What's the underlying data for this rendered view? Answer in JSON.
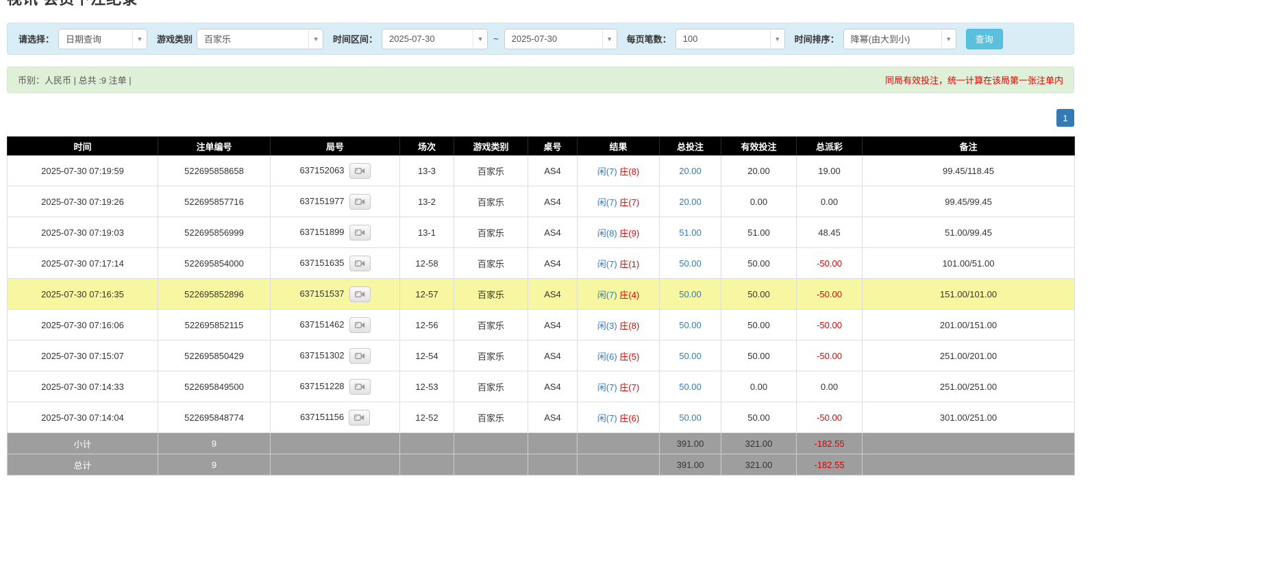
{
  "page": {
    "title": "视讯 会员下注纪录"
  },
  "colors": {
    "header_bg": "#000000",
    "filter_bar_bg": "#d9edf7",
    "summary_bar_bg": "#dff0d8",
    "highlight_row": "#f7f7a1",
    "link_blue": "#337ab7",
    "negative_red": "#e60000",
    "footer_gray": "#9e9e9e",
    "search_button_teal": "#5bc0de",
    "pagination_blue": "#337ab7"
  },
  "filters": {
    "select_label": "请选择：",
    "select_value": "日期查询",
    "game_type_label": "游戏类别",
    "game_type_value": "百家乐",
    "time_range_label": "时间区间：",
    "time_from": "2025-07-30",
    "time_separator": "~",
    "time_to": "2025-07-30",
    "page_size_label": "每页笔数：",
    "page_size_value": "100",
    "sort_label": "时间排序：",
    "sort_value": "降幂(由大到小)",
    "search_button": "查询",
    "arrow": "▼"
  },
  "summary": {
    "left": "币别：人民币 | 总共 :9 注单 |",
    "right": "同局有效投注，统一计算在该局第一张注单内"
  },
  "pagination": {
    "current": "1"
  },
  "table": {
    "headers": [
      "时间",
      "注单编号",
      "局号",
      "场次",
      "游戏类别",
      "桌号",
      "结果",
      "总投注",
      "有效投注",
      "总派彩",
      "备注"
    ],
    "rows": [
      {
        "time": "2025-07-30 07:19:59",
        "bet_id": "522695858658",
        "round_id": "637152063",
        "session": "13-3",
        "game_type": "百家乐",
        "table_no": "AS4",
        "result_player": "闲(7)",
        "result_banker": "庄(8)",
        "total_bet": "20.00",
        "valid_bet": "20.00",
        "payout": "19.00",
        "note": "99.45/118.45",
        "highlighted": false
      },
      {
        "time": "2025-07-30 07:19:26",
        "bet_id": "522695857716",
        "round_id": "637151977",
        "session": "13-2",
        "game_type": "百家乐",
        "table_no": "AS4",
        "result_player": "闲(7)",
        "result_banker": "庄(7)",
        "total_bet": "20.00",
        "valid_bet": "0.00",
        "payout": "0.00",
        "note": "99.45/99.45",
        "highlighted": false
      },
      {
        "time": "2025-07-30 07:19:03",
        "bet_id": "522695856999",
        "round_id": "637151899",
        "session": "13-1",
        "game_type": "百家乐",
        "table_no": "AS4",
        "result_player": "闲(8)",
        "result_banker": "庄(9)",
        "total_bet": "51.00",
        "valid_bet": "51.00",
        "payout": "48.45",
        "note": "51.00/99.45",
        "highlighted": false
      },
      {
        "time": "2025-07-30 07:17:14",
        "bet_id": "522695854000",
        "round_id": "637151635",
        "session": "12-58",
        "game_type": "百家乐",
        "table_no": "AS4",
        "result_player": "闲(7)",
        "result_banker": "庄(1)",
        "total_bet": "50.00",
        "valid_bet": "50.00",
        "payout": "-50.00",
        "note": "101.00/51.00",
        "highlighted": false
      },
      {
        "time": "2025-07-30 07:16:35",
        "bet_id": "522695852896",
        "round_id": "637151537",
        "session": "12-57",
        "game_type": "百家乐",
        "table_no": "AS4",
        "result_player": "闲(7)",
        "result_banker": "庄(4)",
        "total_bet": "50.00",
        "valid_bet": "50.00",
        "payout": "-50.00",
        "note": "151.00/101.00",
        "highlighted": true
      },
      {
        "time": "2025-07-30 07:16:06",
        "bet_id": "522695852115",
        "round_id": "637151462",
        "session": "12-56",
        "game_type": "百家乐",
        "table_no": "AS4",
        "result_player": "闲(3)",
        "result_banker": "庄(8)",
        "total_bet": "50.00",
        "valid_bet": "50.00",
        "payout": "-50.00",
        "note": "201.00/151.00",
        "highlighted": false
      },
      {
        "time": "2025-07-30 07:15:07",
        "bet_id": "522695850429",
        "round_id": "637151302",
        "session": "12-54",
        "game_type": "百家乐",
        "table_no": "AS4",
        "result_player": "闲(6)",
        "result_banker": "庄(5)",
        "total_bet": "50.00",
        "valid_bet": "50.00",
        "payout": "-50.00",
        "note": "251.00/201.00",
        "highlighted": false
      },
      {
        "time": "2025-07-30 07:14:33",
        "bet_id": "522695849500",
        "round_id": "637151228",
        "session": "12-53",
        "game_type": "百家乐",
        "table_no": "AS4",
        "result_player": "闲(7)",
        "result_banker": "庄(7)",
        "total_bet": "50.00",
        "valid_bet": "0.00",
        "payout": "0.00",
        "note": "251.00/251.00",
        "highlighted": false
      },
      {
        "time": "2025-07-30 07:14:04",
        "bet_id": "522695848774",
        "round_id": "637151156",
        "session": "12-52",
        "game_type": "百家乐",
        "table_no": "AS4",
        "result_player": "闲(7)",
        "result_banker": "庄(6)",
        "total_bet": "50.00",
        "valid_bet": "50.00",
        "payout": "-50.00",
        "note": "301.00/251.00",
        "highlighted": false
      }
    ],
    "subtotal": {
      "label": "小计",
      "count": "9",
      "total_bet": "391.00",
      "valid_bet": "321.00",
      "payout": "-182.55"
    },
    "total": {
      "label": "总计",
      "count": "9",
      "total_bet": "391.00",
      "valid_bet": "321.00",
      "payout": "-182.55"
    }
  }
}
